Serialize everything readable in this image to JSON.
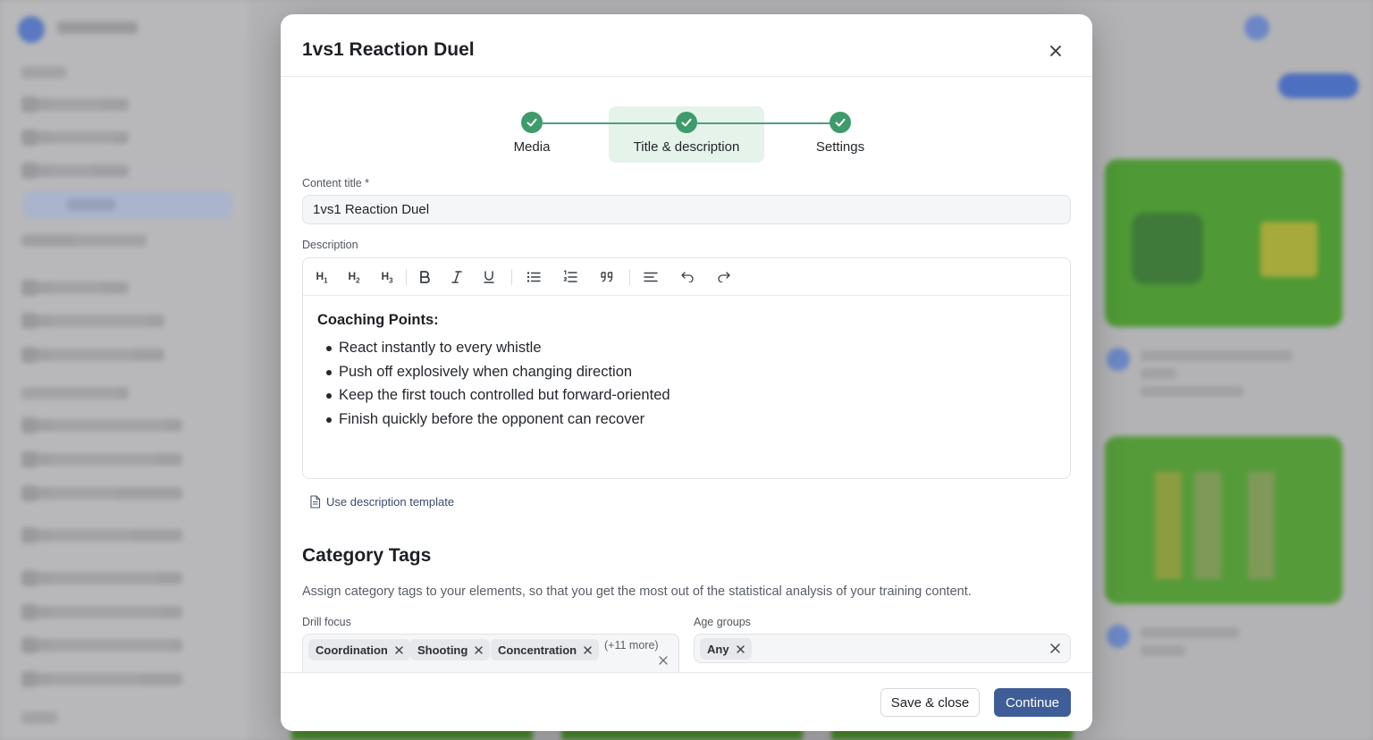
{
  "modal": {
    "title": "1vs1 Reaction Duel",
    "close_icon": "close-icon"
  },
  "stepper": {
    "steps": [
      {
        "label": "Media",
        "status": "complete"
      },
      {
        "label": "Title & description",
        "status": "complete",
        "active": true
      },
      {
        "label": "Settings",
        "status": "complete"
      }
    ],
    "accent_color": "#3f9a6c"
  },
  "content_title": {
    "label": "Content title *",
    "value": "1vs1 Reaction Duel"
  },
  "description": {
    "label": "Description",
    "toolbar": [
      {
        "name": "heading-1",
        "icon": "h1-icon"
      },
      {
        "name": "heading-2",
        "icon": "h2-icon"
      },
      {
        "name": "heading-3",
        "icon": "h3-icon"
      },
      {
        "name": "bold",
        "icon": "bold-icon"
      },
      {
        "name": "italic",
        "icon": "italic-icon"
      },
      {
        "name": "underline",
        "icon": "underline-icon"
      },
      {
        "name": "bullet-list",
        "icon": "bullet-list-icon"
      },
      {
        "name": "ordered-list",
        "icon": "ordered-list-icon"
      },
      {
        "name": "quote",
        "icon": "quote-icon"
      },
      {
        "name": "align",
        "icon": "align-left-icon"
      },
      {
        "name": "undo",
        "icon": "undo-icon"
      },
      {
        "name": "redo",
        "icon": "redo-icon"
      }
    ],
    "heading": "Coaching Points:",
    "bullets": [
      "React instantly to every whistle",
      "Push off explosively when changing direction",
      "Keep the first touch controlled but forward-oriented",
      "Finish quickly before the opponent can recover"
    ],
    "template_link": "Use description template"
  },
  "category_tags": {
    "title": "Category Tags",
    "description": "Assign category tags to your elements, so that you get the most out of the statistical analysis of your training content.",
    "drill_focus": {
      "label": "Drill focus",
      "tags": [
        "Coordination",
        "Shooting",
        "Concentration"
      ],
      "more": "(+11 more)"
    },
    "age_groups": {
      "label": "Age groups",
      "tags": [
        "Any"
      ]
    }
  },
  "footer": {
    "save_close": "Save & close",
    "continue": "Continue",
    "primary_color": "#3f5d97"
  }
}
